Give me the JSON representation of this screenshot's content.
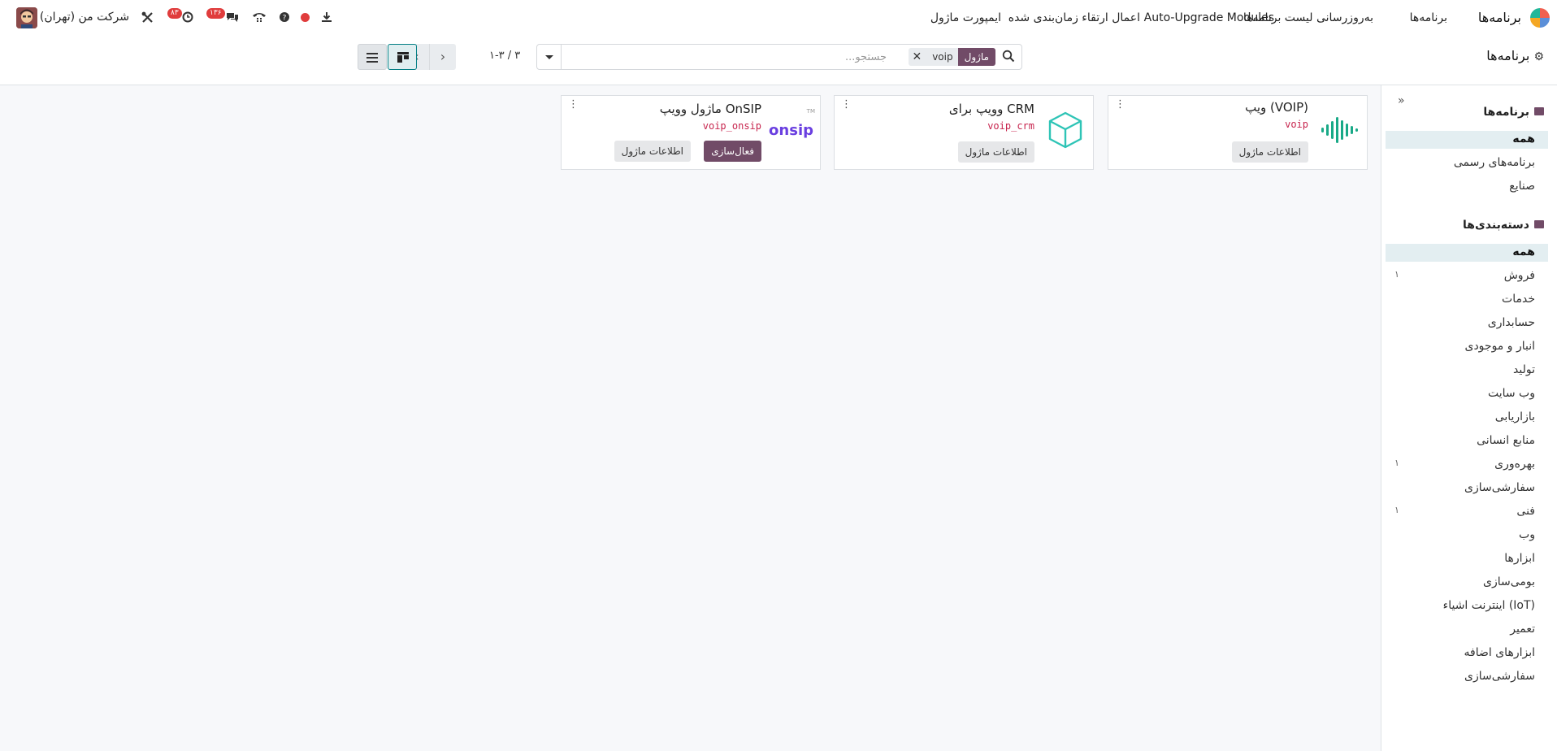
{
  "navbar": {
    "brand": "برنامه‌ها",
    "menu": [
      "برنامه‌ها",
      "به‌روزرسانی لیست برنامه‌ها",
      "Auto-Upgrade Modules",
      "اعمال ارتقاء زمان‌بندی شده",
      "ایمپورت ماژول"
    ],
    "messages_badge": "۱۳۶",
    "activities_badge": "۸۳",
    "company": "شرکت من (تهران)"
  },
  "control_panel": {
    "title": "برنامه‌ها",
    "search": {
      "facet_label": "ماژول",
      "facet_value": "voip",
      "placeholder": "جستجو..."
    },
    "pager": "۱-۳ / ۳"
  },
  "sidebar": {
    "apps_heading": "برنامه‌ها",
    "apps": [
      {
        "label": "همه",
        "active": true
      },
      {
        "label": "برنامه‌های رسمی"
      },
      {
        "label": "صنایع"
      }
    ],
    "categories_heading": "دسته‌بندی‌ها",
    "categories": [
      {
        "label": "همه",
        "active": true,
        "count": ""
      },
      {
        "label": "فروش",
        "count": "۱"
      },
      {
        "label": "خدمات",
        "count": ""
      },
      {
        "label": "حسابداری",
        "count": ""
      },
      {
        "label": "انبار و موجودی",
        "count": ""
      },
      {
        "label": "تولید",
        "count": ""
      },
      {
        "label": "وب سایت",
        "count": ""
      },
      {
        "label": "بازاریابی",
        "count": ""
      },
      {
        "label": "منابع انسانی",
        "count": ""
      },
      {
        "label": "بهره‌وری",
        "count": "۱"
      },
      {
        "label": "سفارشی‌سازی",
        "count": ""
      },
      {
        "label": "فنی",
        "count": "۱"
      },
      {
        "label": "وب",
        "count": ""
      },
      {
        "label": "ابزارها",
        "count": ""
      },
      {
        "label": "بومی‌سازی",
        "count": ""
      },
      {
        "label": "اینترنت اشیاء (IoT)",
        "count": ""
      },
      {
        "label": "تعمیر",
        "count": ""
      },
      {
        "label": "ابزارهای اضافه",
        "count": ""
      },
      {
        "label": "سفارشی‌سازی",
        "count": ""
      }
    ]
  },
  "cards": [
    {
      "title": "ویپ (VOIP)",
      "technical": "voip",
      "info_label": "اطلاعات ماژول",
      "icon": "voip-waveform-icon"
    },
    {
      "title": "وویپ برای CRM",
      "technical": "voip_crm",
      "info_label": "اطلاعات ماژول",
      "icon": "cube-icon"
    },
    {
      "title": "ماژول وویپ OnSIP",
      "technical": "voip_onsip",
      "info_label": "اطلاعات ماژول",
      "activate_label": "فعال‌سازی",
      "icon": "onsip-logo",
      "logo_text": "onsip",
      "tm": "TM"
    }
  ],
  "colors": {
    "primary": "#714b67",
    "teal": "#017e84",
    "technical_name": "#c7254e",
    "badge": "#e03c3c"
  }
}
